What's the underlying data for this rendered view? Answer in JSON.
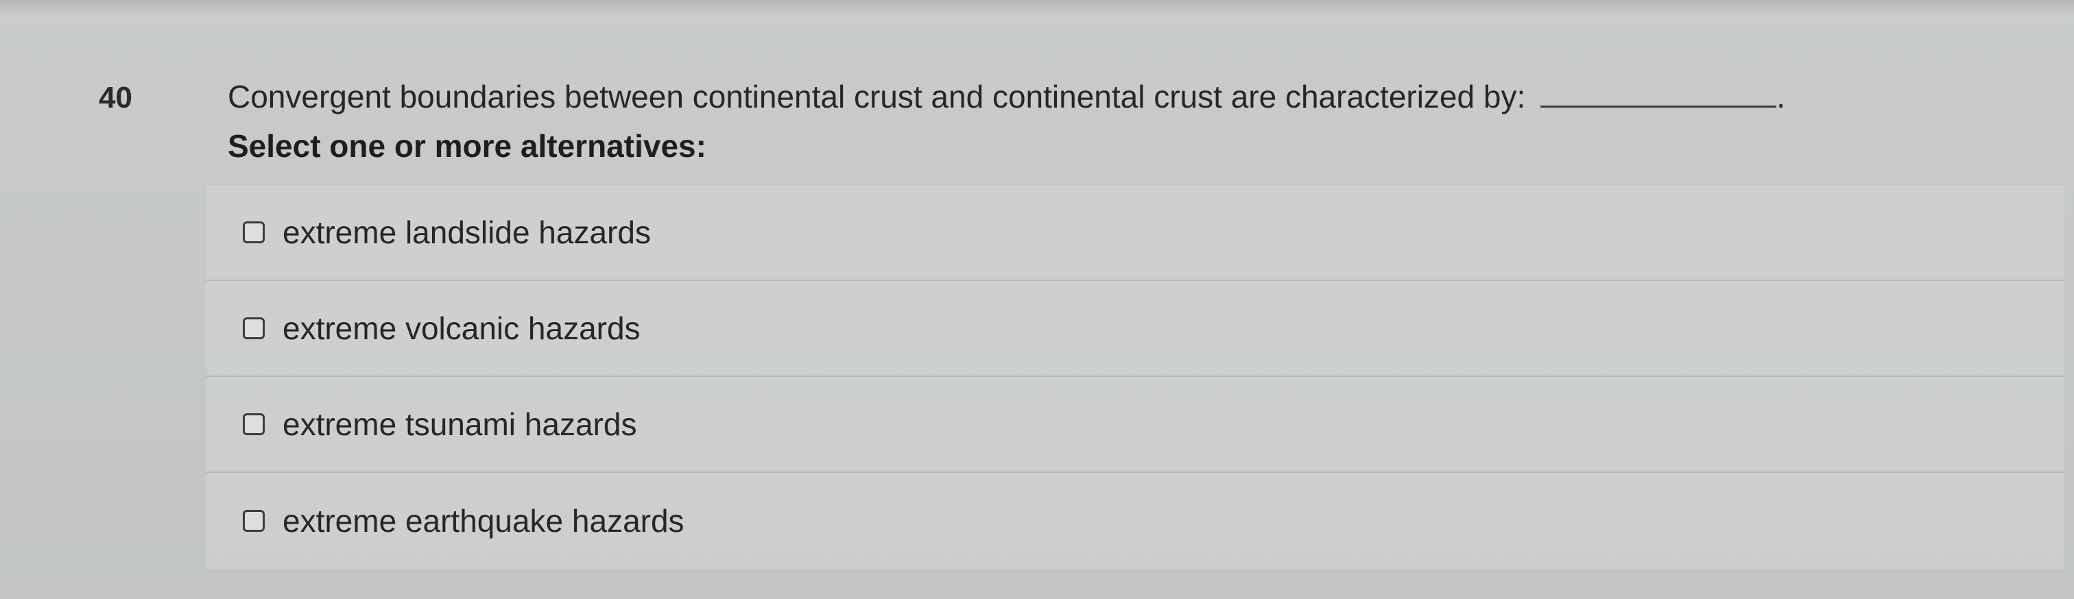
{
  "question": {
    "number": "40",
    "prompt": "Convergent boundaries between continental crust and continental crust are characterized by:",
    "blank_suffix": ".",
    "instruction": "Select one or more alternatives:"
  },
  "options": [
    {
      "label": "extreme landslide hazards",
      "checked": false
    },
    {
      "label": "extreme volcanic hazards",
      "checked": false
    },
    {
      "label": "extreme tsunami hazards",
      "checked": false
    },
    {
      "label": "extreme earthquake hazards",
      "checked": false
    }
  ]
}
